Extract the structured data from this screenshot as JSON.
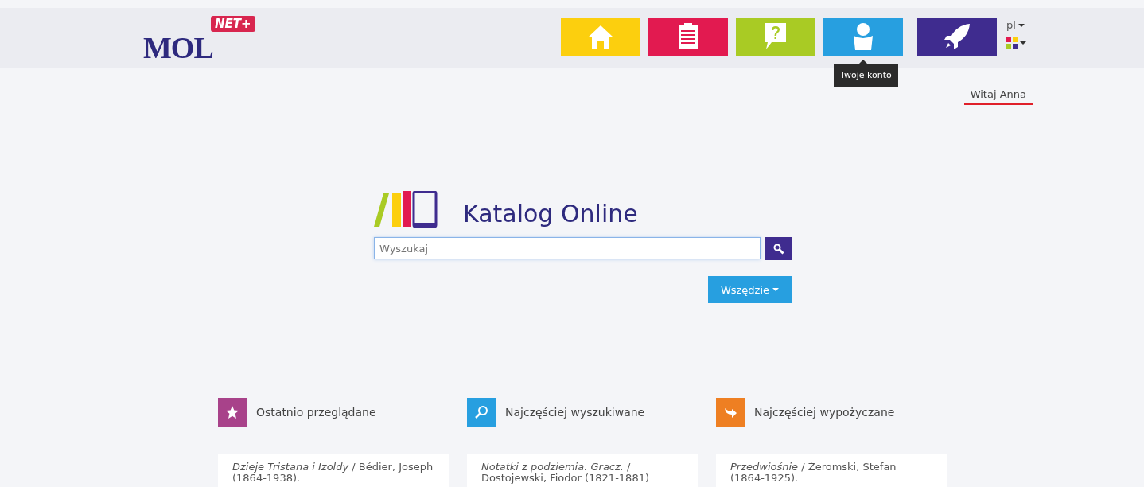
{
  "header": {
    "logo": {
      "name": "MOL",
      "badge": "NET+"
    },
    "nav": [
      {
        "kind": "home",
        "color": "#fccf0e"
      },
      {
        "kind": "clipboard",
        "color": "#e21a50"
      },
      {
        "kind": "help",
        "color": "#a9cb24"
      },
      {
        "kind": "account",
        "color": "#279fe0",
        "tooltip": "Twoje konto"
      },
      {
        "kind": "rocket",
        "color": "#3f2c8f"
      }
    ],
    "language": "pl"
  },
  "greeting": "Witaj Anna",
  "catalog": {
    "title": "Katalog Online",
    "search": {
      "placeholder": "Wyszukaj"
    },
    "scope": "Wszędzie"
  },
  "sections": [
    {
      "kind": "star",
      "color": "#a8428a",
      "title": "Ostatnio przeglądane",
      "item": "*Dzieje Tristana i Izoldy* / Bédier, Joseph (1864-1938)."
    },
    {
      "kind": "search",
      "color": "#279fe0",
      "title": "Najczęściej wyszukiwane",
      "item": "*Notatki z podziemia. Gracz.* / Dostojewski, Fiodor (1821-1881)"
    },
    {
      "kind": "share",
      "color": "#ee7f22",
      "title": "Najczęściej wypożyczane",
      "item": "*Przedwiośnie* / Żeromski, Stefan (1864-1925)."
    }
  ]
}
